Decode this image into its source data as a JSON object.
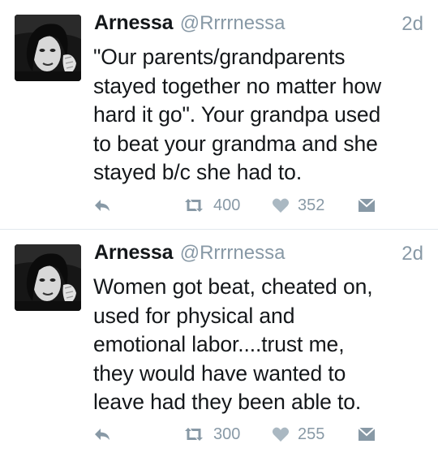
{
  "tweets": [
    {
      "author": {
        "name": "Arnessa",
        "handle": "@Rrrrnessa"
      },
      "time": "2d",
      "text": "\"Our parents/grandparents\nstayed together no matter how\nhard it go\". Your grandpa used\nto beat your grandma and she\nstayed b/c she had to.",
      "retweets": "400",
      "likes": "352"
    },
    {
      "author": {
        "name": "Arnessa",
        "handle": "@Rrrrnessa"
      },
      "time": "2d",
      "text": "Women got beat, cheated on,\nused for physical and\nemotional labor....trust me,\nthey would have wanted to\nleave had they been able to.",
      "retweets": "300",
      "likes": "255"
    }
  ],
  "icons": {
    "reply": "reply-icon",
    "retweet": "retweet-icon",
    "like": "heart-icon",
    "dm": "direct-message-icon",
    "avatar": "avatar"
  },
  "colors": {
    "text": "#14171a",
    "secondary": "#8899a6",
    "divider": "#e1e8ed"
  }
}
